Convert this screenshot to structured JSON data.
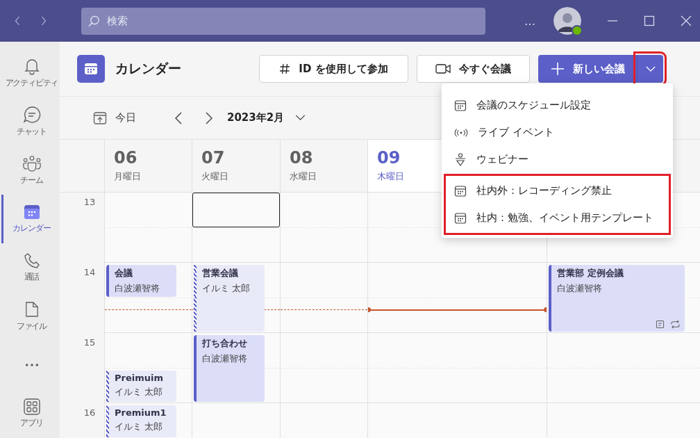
{
  "title_bar": {
    "search": {
      "placeholder": "検索"
    },
    "more": "…",
    "online": true
  },
  "nav_rail": [
    {
      "label": "アクティビティ",
      "selected": false
    },
    {
      "label": "チャット",
      "selected": false
    },
    {
      "label": "チーム",
      "selected": false
    },
    {
      "label": "カレンダー",
      "selected": true
    },
    {
      "label": "通話",
      "selected": false
    },
    {
      "label": "ファイル",
      "selected": false
    },
    {
      "kind": "more",
      "selected": false
    },
    {
      "label": "アプリ",
      "selected": false
    }
  ],
  "header": {
    "title": "カレンダー",
    "join_button": "ID を使用して参加",
    "meet_now_button": "今すぐ会議",
    "new_meeting_button": "新しい会議",
    "dropdown_highlighted": true
  },
  "toolbar": {
    "today": "今日",
    "month": "2023年2月"
  },
  "hours": [
    "13",
    "14",
    "15",
    "16"
  ],
  "days": [
    {
      "date": "06",
      "weekday": "月曜日",
      "today": false,
      "events": [
        {
          "title": "会議",
          "organizer": "白波瀬智将",
          "tentative": false
        },
        {
          "title": "Preimuim",
          "organizer": "イルミ 太郎",
          "tentative": true
        },
        {
          "title": "Premium1",
          "organizer": "イルミ 太郎",
          "tentative": true
        }
      ]
    },
    {
      "date": "07",
      "weekday": "火曜日",
      "today": false,
      "slot_selected": true,
      "events": [
        {
          "title": "営業会議",
          "organizer": "イルミ 太郎",
          "tentative": true
        },
        {
          "title": "打ち合わせ",
          "organizer": "白波瀬智将",
          "tentative": false
        }
      ]
    },
    {
      "date": "08",
      "weekday": "水曜日",
      "today": false
    },
    {
      "date": "09",
      "weekday": "木曜日",
      "today": true
    },
    {
      "events": [
        {
          "title": "営業部 定例会議",
          "organizer": "白波瀬智将",
          "tentative": false,
          "recurring": true,
          "has_notes": true
        }
      ]
    }
  ],
  "menu": [
    {
      "label": "会議のスケジュール設定",
      "kind": "calendar",
      "highlighted": false
    },
    {
      "label": "ライブ イベント",
      "kind": "live",
      "highlighted": false
    },
    {
      "label": "ウェビナー",
      "kind": "webinar",
      "highlighted": false
    },
    {
      "label": "社内外：レコーディング禁止",
      "kind": "calendar",
      "highlighted": true
    },
    {
      "label": "社内：勉強、イベント用テンプレート",
      "kind": "calendar",
      "highlighted": true
    }
  ]
}
